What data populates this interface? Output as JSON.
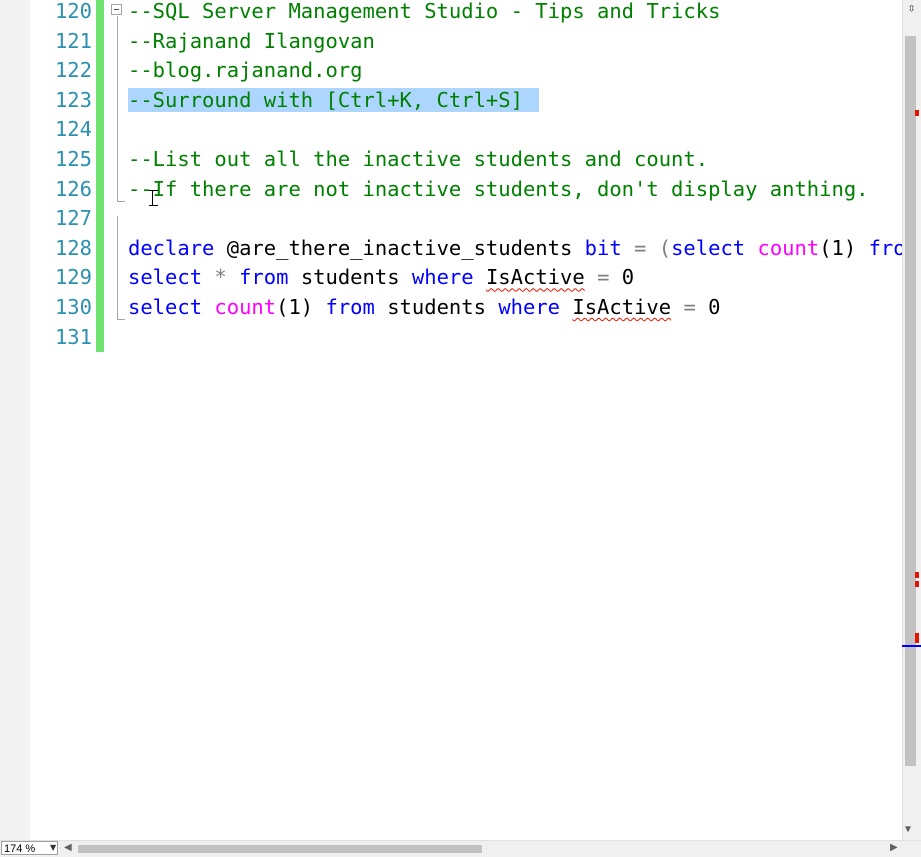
{
  "editor": {
    "lines": [
      {
        "num": "120",
        "text": "--SQL Server Management Studio - Tips and Tricks"
      },
      {
        "num": "121",
        "text": "--Rajanand Ilangovan"
      },
      {
        "num": "122",
        "text": "--blog.rajanand.org"
      },
      {
        "num": "123",
        "text": "--Surround with [Ctrl+K, Ctrl+S]"
      },
      {
        "num": "124",
        "text": ""
      },
      {
        "num": "125",
        "text": "--List out all the inactive students and count."
      },
      {
        "num": "126",
        "text": "--If there are not inactive students, don't display anthing."
      },
      {
        "num": "127",
        "text": ""
      },
      {
        "num": "128",
        "text": "declare @are_there_inactive_students bit = (select count(1) fro"
      },
      {
        "num": "129",
        "text": "select * from students where IsActive = 0"
      },
      {
        "num": "130",
        "text": "select count(1) from students where IsActive = 0"
      },
      {
        "num": "131",
        "text": ""
      }
    ],
    "tokens": {
      "declare": "declare",
      "variable": "@are_there_inactive_students",
      "bit": "bit",
      "eq": "=",
      "paren_open": "(",
      "select": "select",
      "count": "count",
      "one": "(1)",
      "from_partial": "fro",
      "star": "*",
      "from": "from",
      "students": "students",
      "where": "where",
      "isactive": "IsActive",
      "zero": "0"
    }
  },
  "status": {
    "zoom": "174 %"
  },
  "colors": {
    "comment": "#008000",
    "keyword": "#0000ff",
    "function": "#ff00ff",
    "line_number": "#2b91af",
    "selection": "#add6ff",
    "change_bar": "#6fe36f"
  },
  "icons": {
    "fold": "collapse-minus-icon",
    "split": "split-window-icon",
    "cursor": "ibeam-cursor-icon"
  }
}
